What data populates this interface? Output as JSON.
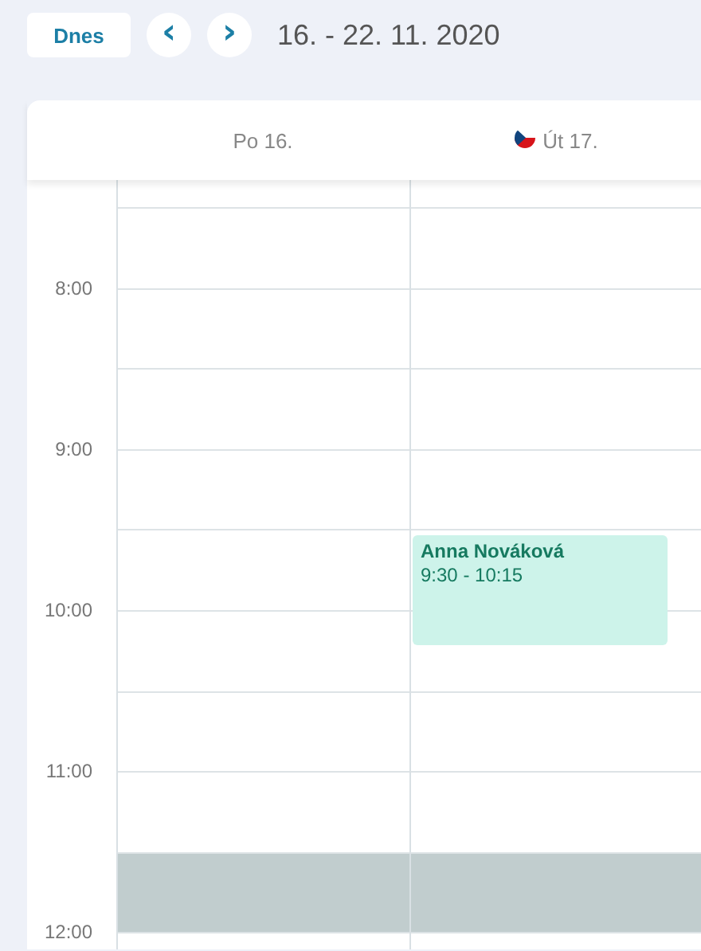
{
  "toolbar": {
    "today": "Dnes",
    "prev": "‹",
    "next": "›",
    "range": "16. - 22. 11. 2020"
  },
  "days": [
    {
      "label": "Po 16.",
      "holiday": false
    },
    {
      "label": "Út 17.",
      "holiday": true
    }
  ],
  "slots": [
    {
      "cells": [
        {
          "blocked": false
        },
        {
          "blocked": false
        }
      ]
    },
    {
      "cells": [
        {
          "blocked": false
        },
        {
          "blocked": false
        }
      ]
    },
    {
      "time": "8:00",
      "cells": [
        {
          "blocked": false
        },
        {
          "blocked": false
        }
      ]
    },
    {
      "cells": [
        {
          "blocked": false
        },
        {
          "blocked": false
        }
      ]
    },
    {
      "time": "9:00",
      "cells": [
        {
          "blocked": false
        },
        {
          "blocked": false
        }
      ]
    },
    {
      "cells": [
        {
          "blocked": false
        },
        {
          "blocked": false,
          "events": [
            {
              "name": "Anna Nováková",
              "time": "9:30 - 10:15"
            }
          ]
        }
      ]
    },
    {
      "time": "10:00",
      "cells": [
        {
          "blocked": false
        },
        {
          "blocked": false
        }
      ]
    },
    {
      "cells": [
        {
          "blocked": false
        },
        {
          "blocked": false
        }
      ]
    },
    {
      "time": "11:00",
      "cells": [
        {
          "blocked": false
        },
        {
          "blocked": false
        }
      ]
    },
    {
      "cells": [
        {
          "blocked": true
        },
        {
          "blocked": true
        }
      ]
    },
    {
      "time": "12:00",
      "cells": [
        {
          "blocked": false
        },
        {
          "blocked": false
        }
      ]
    }
  ]
}
